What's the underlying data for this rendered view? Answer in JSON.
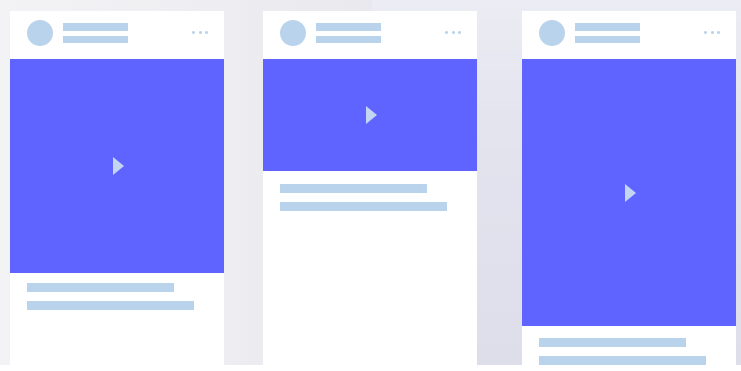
{
  "feed": {
    "cards": [
      {
        "media_label": "play-video"
      },
      {
        "media_label": "play-video"
      },
      {
        "media_label": "play-video"
      }
    ]
  },
  "colors": {
    "media_bg": "#5f63ff",
    "placeholder": "#b9d3ec",
    "card_bg": "#ffffff"
  }
}
